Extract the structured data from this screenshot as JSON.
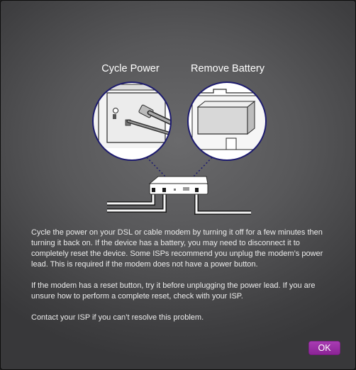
{
  "dialog": {
    "captions": {
      "cycle_power": "Cycle Power",
      "remove_battery": "Remove Battery"
    },
    "paragraphs": [
      "Cycle the power on your DSL or cable modem by turning it off for a few minutes then turning it back on. If the device has a battery, you may need to disconnect it to completely reset the device. Some ISPs recommend you unplug the modem’s power lead. This is required if the modem does not have a power button.",
      "If the modem has a reset button, try it before unplugging the power lead. If you are unsure how to perform a complete reset, check with your ISP.",
      "Contact your ISP if you can’t resolve this problem."
    ],
    "ok_label": "OK"
  },
  "colors": {
    "accent": "#9b2fa6",
    "circle_border": "#1d1b6e",
    "text": "#ececec"
  },
  "icons": [
    "modem-icon",
    "power-cable-icon",
    "battery-icon"
  ]
}
